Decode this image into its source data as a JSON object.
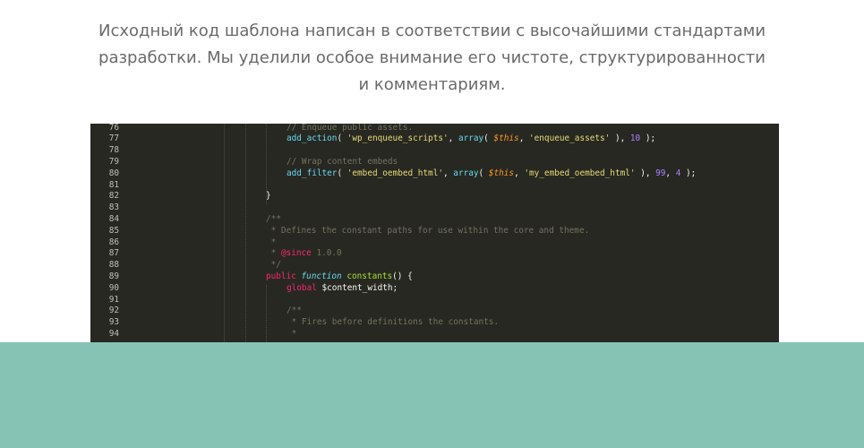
{
  "description": "Исходный код шаблона написан в соответствии с высочайшими стандартами разработки. Мы уделили особое внимание его чистоте, структурированности и комментариям.",
  "code_image": {
    "lines": [
      {
        "n": "76",
        "indent": 2,
        "tokens": [
          {
            "t": "// Enqueue public assets.",
            "c": "com"
          }
        ]
      },
      {
        "n": "77",
        "indent": 2,
        "tokens": [
          {
            "t": "add_action",
            "c": "fn"
          },
          {
            "t": "( ",
            "c": "txt"
          },
          {
            "t": "'wp_enqueue_scripts'",
            "c": "str"
          },
          {
            "t": ", ",
            "c": "txt"
          },
          {
            "t": "array",
            "c": "fn"
          },
          {
            "t": "( ",
            "c": "txt"
          },
          {
            "t": "$this",
            "c": "var"
          },
          {
            "t": ", ",
            "c": "txt"
          },
          {
            "t": "'enqueue_assets'",
            "c": "str"
          },
          {
            "t": " ), ",
            "c": "txt"
          },
          {
            "t": "10",
            "c": "num"
          },
          {
            "t": " );",
            "c": "txt"
          }
        ]
      },
      {
        "n": "78",
        "indent": 0,
        "tokens": []
      },
      {
        "n": "79",
        "indent": 2,
        "tokens": [
          {
            "t": "// Wrap content embeds",
            "c": "com"
          }
        ]
      },
      {
        "n": "80",
        "indent": 2,
        "tokens": [
          {
            "t": "add_filter",
            "c": "fn"
          },
          {
            "t": "( ",
            "c": "txt"
          },
          {
            "t": "'embed_oembed_html'",
            "c": "str"
          },
          {
            "t": ", ",
            "c": "txt"
          },
          {
            "t": "array",
            "c": "fn"
          },
          {
            "t": "( ",
            "c": "txt"
          },
          {
            "t": "$this",
            "c": "var"
          },
          {
            "t": ", ",
            "c": "txt"
          },
          {
            "t": "'my_embed_oembed_html'",
            "c": "str"
          },
          {
            "t": " ), ",
            "c": "txt"
          },
          {
            "t": "99",
            "c": "num"
          },
          {
            "t": ", ",
            "c": "txt"
          },
          {
            "t": "4",
            "c": "num"
          },
          {
            "t": " );",
            "c": "txt"
          }
        ]
      },
      {
        "n": "81",
        "indent": 0,
        "tokens": []
      },
      {
        "n": "82",
        "indent": 1,
        "tokens": [
          {
            "t": "}",
            "c": "txt"
          }
        ]
      },
      {
        "n": "83",
        "indent": 0,
        "tokens": []
      },
      {
        "n": "84",
        "indent": 1,
        "tokens": [
          {
            "t": "/**",
            "c": "com"
          }
        ]
      },
      {
        "n": "85",
        "indent": 1,
        "tokens": [
          {
            "t": " * Defines the constant paths for use within the core and theme.",
            "c": "com"
          }
        ]
      },
      {
        "n": "86",
        "indent": 1,
        "tokens": [
          {
            "t": " *",
            "c": "com"
          }
        ]
      },
      {
        "n": "87",
        "indent": 1,
        "tokens": [
          {
            "t": " * ",
            "c": "com"
          },
          {
            "t": "@since",
            "c": "kw"
          },
          {
            "t": " 1.0.0",
            "c": "com"
          }
        ]
      },
      {
        "n": "88",
        "indent": 1,
        "tokens": [
          {
            "t": " */",
            "c": "com"
          }
        ]
      },
      {
        "n": "89",
        "indent": 1,
        "tokens": [
          {
            "t": "public",
            "c": "kw"
          },
          {
            "t": " ",
            "c": "txt"
          },
          {
            "t": "function",
            "c": "fnkw"
          },
          {
            "t": " ",
            "c": "txt"
          },
          {
            "t": "constants",
            "c": "def"
          },
          {
            "t": "() {",
            "c": "txt"
          }
        ]
      },
      {
        "n": "90",
        "indent": 2,
        "tokens": [
          {
            "t": "global",
            "c": "kw"
          },
          {
            "t": " $content_width;",
            "c": "txt"
          }
        ]
      },
      {
        "n": "91",
        "indent": 0,
        "tokens": []
      },
      {
        "n": "92",
        "indent": 2,
        "tokens": [
          {
            "t": "/**",
            "c": "com"
          }
        ]
      },
      {
        "n": "93",
        "indent": 2,
        "tokens": [
          {
            "t": " * Fires before definitions the constants.",
            "c": "com"
          }
        ]
      },
      {
        "n": "94",
        "indent": 2,
        "tokens": [
          {
            "t": " *",
            "c": "com"
          }
        ]
      }
    ]
  },
  "colors": {
    "code_background": "#272822",
    "teal_band": "#87c3b5",
    "description_text": "#6a6a6a"
  }
}
